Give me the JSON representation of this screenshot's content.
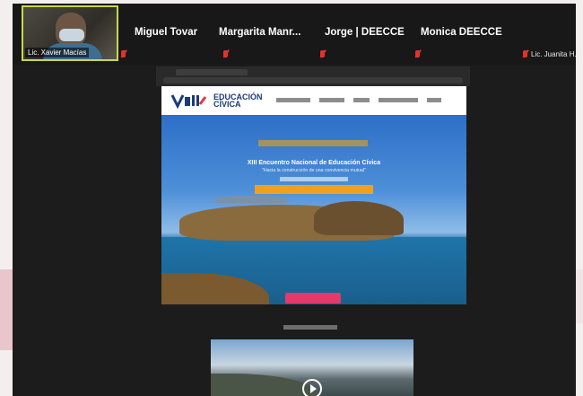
{
  "meeting": {
    "self_tile": {
      "name": "Lic. Xavier Macías"
    },
    "participants": [
      {
        "name": "Miguel Tovar"
      },
      {
        "name": "Margarita  Manr..."
      },
      {
        "name": "Jorge | DEECCE"
      },
      {
        "name": "Monica DEECCE"
      }
    ],
    "extra_tile": {
      "name": "Lic. Juanita H..."
    }
  },
  "shared_page": {
    "logo_text_line1": "EDUCACIÓN",
    "logo_text_line2": "CÍVICA",
    "hero_title": "XIII Encuentro Nacional de Educación Cívica",
    "hero_subtitle": "\"Hacia la construcción de una convivencia mutual\""
  },
  "colors": {
    "active_speaker": "#c8d84a",
    "muted_mic": "#e0332e",
    "cta": "#e23a6a",
    "registration_bar": "#f0a020"
  }
}
